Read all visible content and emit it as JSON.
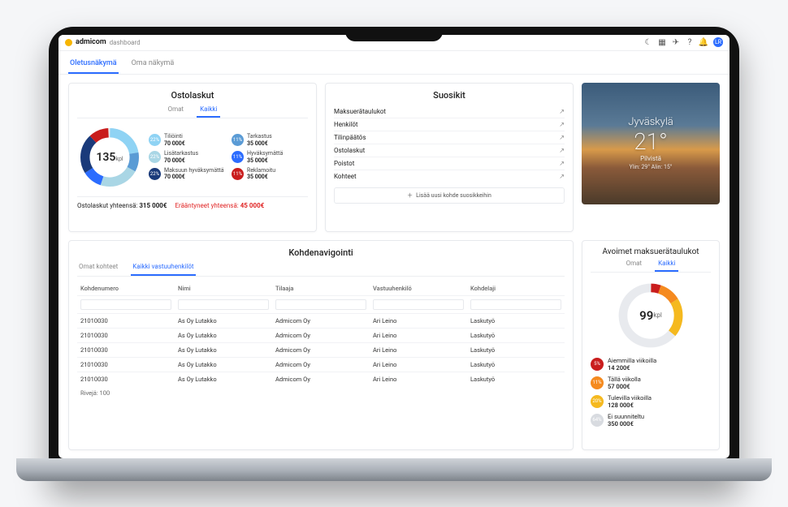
{
  "brand": {
    "name": "admicom",
    "sub": "dashboard"
  },
  "toolbar_icons": {
    "moon": "moon-icon",
    "grid": "grid-icon",
    "send": "send-icon",
    "help": "help-icon",
    "bell": "bell-icon",
    "avatar_initial": "LR"
  },
  "main_tabs": {
    "active": "Oletusnäkymä",
    "other": "Oma näkymä"
  },
  "ostolaskut": {
    "title": "Ostolaskut",
    "tabs": {
      "omat": "Omat",
      "kaikki": "Kaikki"
    },
    "center_value": "135",
    "center_unit": "kpl",
    "items": [
      {
        "pct": "22%",
        "label": "Tiliöinti",
        "value": "70 000€",
        "color": "#8fd3f4"
      },
      {
        "pct": "11%",
        "label": "Tarkastus",
        "value": "35 000€",
        "color": "#5a9bd5"
      },
      {
        "pct": "22%",
        "label": "Lisätarkastus",
        "value": "70 000€",
        "color": "#a9d6e5"
      },
      {
        "pct": "11%",
        "label": "Hyväksymättä",
        "value": "35 000€",
        "color": "#2b6cff"
      },
      {
        "pct": "22%",
        "label": "Maksuun hyväksymättä",
        "value": "70 000€",
        "color": "#1a3a7a"
      },
      {
        "pct": "11%",
        "label": "Reklamoitu",
        "value": "35 000€",
        "color": "#c91d1d"
      }
    ],
    "total_label": "Ostolaskut yhteensä:",
    "total_value": "315 000€",
    "overdue_label": "Erääntyneet yhteensä:",
    "overdue_value": "45 000€"
  },
  "suosikit": {
    "title": "Suosikit",
    "items": [
      "Maksuerätaulukot",
      "Henkilöt",
      "Tilinpäätös",
      "Ostolaskut",
      "Poistot",
      "Kohteet"
    ],
    "add_label": "Lisää uusi kohde suosikkeihin"
  },
  "weather": {
    "city": "Jyväskylä",
    "temp": "21°",
    "desc": "Pilvistä",
    "hilo": "Ylin: 29°  Alin: 15°"
  },
  "kohde": {
    "title": "Kohdenavigointi",
    "tabs": {
      "omat": "Omat kohteet",
      "kaikki": "Kaikki vastuuhenkilöt"
    },
    "headers": [
      "Kohdenumero",
      "Nimi",
      "Tilaaja",
      "Vastuuhenkilö",
      "Kohdelaji"
    ],
    "rows": [
      [
        "21010030",
        "As Oy Lutakko",
        "Admicom Oy",
        "Ari Leino",
        "Laskutyö"
      ],
      [
        "21010030",
        "As Oy Lutakko",
        "Admicom Oy",
        "Ari Leino",
        "Laskutyö"
      ],
      [
        "21010030",
        "As Oy Lutakko",
        "Admicom Oy",
        "Ari Leino",
        "Laskutyö"
      ],
      [
        "21010030",
        "As Oy Lutakko",
        "Admicom Oy",
        "Ari Leino",
        "Laskutyö"
      ],
      [
        "21010030",
        "As Oy Lutakko",
        "Admicom Oy",
        "Ari Leino",
        "Laskutyö"
      ]
    ],
    "rows_label": "Rivejä: 100"
  },
  "avoimet": {
    "title": "Avoimet maksuerätaulukot",
    "tabs": {
      "omat": "Omat",
      "kaikki": "Kaikki"
    },
    "center_value": "99",
    "center_unit": "kpl",
    "items": [
      {
        "pct": "5%",
        "label": "Aiemmilla viikoilla",
        "value": "14 200€",
        "color": "#c91d1d"
      },
      {
        "pct": "11%",
        "label": "Tällä viikolla",
        "value": "57 000€",
        "color": "#f58a1f"
      },
      {
        "pct": "20%",
        "label": "Tulevilla viikoilla",
        "value": "128 000€",
        "color": "#f5b91f"
      },
      {
        "pct": "64%",
        "label": "Ei suunniteltu",
        "value": "350 000€",
        "color": "#d8dbe0"
      }
    ]
  },
  "chart_data": [
    {
      "type": "pie",
      "title": "Ostolaskut",
      "total_count": 135,
      "series": [
        {
          "name": "Tiliöinti",
          "value": 70000,
          "pct": 22
        },
        {
          "name": "Tarkastus",
          "value": 35000,
          "pct": 11
        },
        {
          "name": "Lisätarkastus",
          "value": 70000,
          "pct": 22
        },
        {
          "name": "Hyväksymättä",
          "value": 35000,
          "pct": 11
        },
        {
          "name": "Maksuun hyväksymättä",
          "value": 70000,
          "pct": 22
        },
        {
          "name": "Reklamoitu",
          "value": 35000,
          "pct": 11
        }
      ]
    },
    {
      "type": "pie",
      "title": "Avoimet maksuerätaulukot",
      "total_count": 99,
      "series": [
        {
          "name": "Aiemmilla viikoilla",
          "value": 14200,
          "pct": 5
        },
        {
          "name": "Tällä viikolla",
          "value": 57000,
          "pct": 11
        },
        {
          "name": "Tulevilla viikoilla",
          "value": 128000,
          "pct": 20
        },
        {
          "name": "Ei suunniteltu",
          "value": 350000,
          "pct": 64
        }
      ]
    }
  ]
}
